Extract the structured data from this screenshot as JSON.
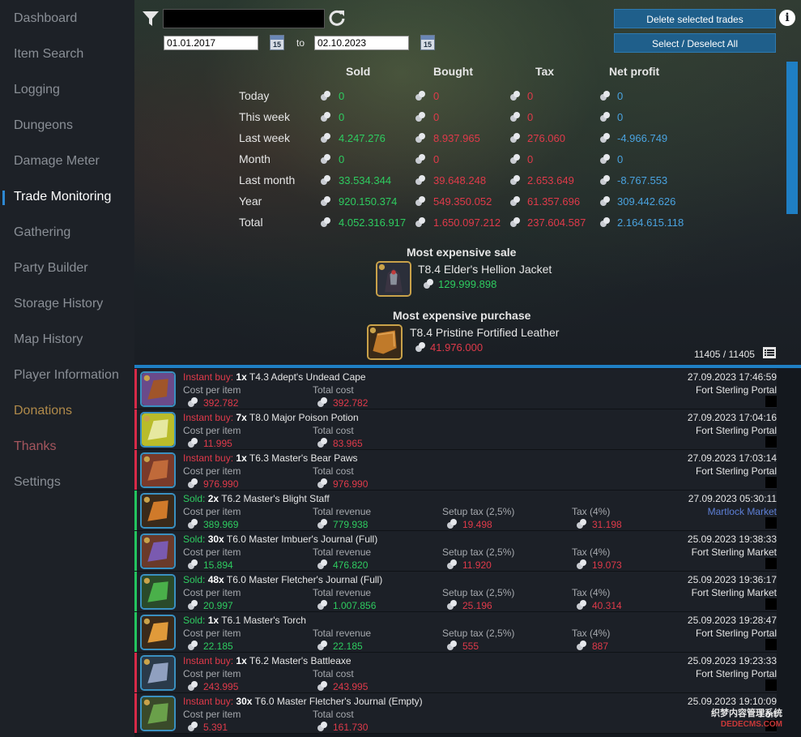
{
  "sidebar": {
    "items": [
      {
        "label": "Dashboard"
      },
      {
        "label": "Item Search"
      },
      {
        "label": "Logging"
      },
      {
        "label": "Dungeons"
      },
      {
        "label": "Damage Meter"
      },
      {
        "label": "Trade Monitoring"
      },
      {
        "label": "Gathering"
      },
      {
        "label": "Party Builder"
      },
      {
        "label": "Storage History"
      },
      {
        "label": "Map History"
      },
      {
        "label": "Player Information"
      },
      {
        "label": "Donations"
      },
      {
        "label": "Thanks"
      },
      {
        "label": "Settings"
      }
    ],
    "active": "Trade Monitoring"
  },
  "filter": {
    "search_value": "",
    "date_from": "01.01.2017",
    "to_label": "to",
    "date_to": "02.10.2023",
    "calendar_day": "15"
  },
  "buttons": {
    "delete": "Delete selected trades",
    "select_all": "Select / Deselect All"
  },
  "stats": {
    "headers": {
      "sold": "Sold",
      "bought": "Bought",
      "tax": "Tax",
      "net": "Net profit"
    },
    "rows": [
      {
        "label": "Today",
        "sold": "0",
        "bought": "0",
        "tax": "0",
        "net": "0"
      },
      {
        "label": "This week",
        "sold": "0",
        "bought": "0",
        "tax": "0",
        "net": "0"
      },
      {
        "label": "Last week",
        "sold": "4.247.276",
        "bought": "8.937.965",
        "tax": "276.060",
        "net": "-4.966.749"
      },
      {
        "label": "Month",
        "sold": "0",
        "bought": "0",
        "tax": "0",
        "net": "0"
      },
      {
        "label": "Last month",
        "sold": "33.534.344",
        "bought": "39.648.248",
        "tax": "2.653.649",
        "net": "-8.767.553"
      },
      {
        "label": "Year",
        "sold": "920.150.374",
        "bought": "549.350.052",
        "tax": "61.357.696",
        "net": "309.442.626"
      },
      {
        "label": "Total",
        "sold": "4.052.316.917",
        "bought": "1.650.097.212",
        "tax": "237.604.587",
        "net": "2.164.615.118"
      }
    ]
  },
  "most_expensive_sale": {
    "title": "Most expensive sale",
    "item": "T8.4 Elder's Hellion Jacket",
    "value": "129.999.898"
  },
  "most_expensive_purchase": {
    "title": "Most expensive purchase",
    "item": "T8.4 Pristine Fortified Leather",
    "value": "41.976.000"
  },
  "count": "11405 / 11405",
  "trades": [
    {
      "kind": "Instant buy:",
      "qty": "1x",
      "item": "T4.3 Adept's Undead Cape",
      "lbl1": "Cost per item",
      "v1": "392.782",
      "lbl2": "Total cost",
      "v2": "392.782",
      "date": "27.09.2023 17:46:59",
      "location": "Fort Sterling Portal"
    },
    {
      "kind": "Instant buy:",
      "qty": "7x",
      "item": "T8.0 Major Poison Potion",
      "lbl1": "Cost per item",
      "v1": "11.995",
      "lbl2": "Total cost",
      "v2": "83.965",
      "date": "27.09.2023 17:04:16",
      "location": "Fort Sterling Portal"
    },
    {
      "kind": "Instant buy:",
      "qty": "1x",
      "item": "T6.3 Master's Bear Paws",
      "lbl1": "Cost per item",
      "v1": "976.990",
      "lbl2": "Total cost",
      "v2": "976.990",
      "date": "27.09.2023 17:03:14",
      "location": "Fort Sterling Portal"
    },
    {
      "kind": "Sold:",
      "qty": "2x",
      "item": "T6.2 Master's Blight Staff",
      "lbl1": "Cost per item",
      "v1": "389.969",
      "lbl2": "Total revenue",
      "v2": "779.938",
      "lbl3": "Setup tax (2,5%)",
      "v3": "19.498",
      "lbl4": "Tax (4%)",
      "v4": "31.198",
      "date": "27.09.2023 05:30:11",
      "location": "Martlock Market"
    },
    {
      "kind": "Sold:",
      "qty": "30x",
      "item": "T6.0 Master Imbuer's Journal (Full)",
      "lbl1": "Cost per item",
      "v1": "15.894",
      "lbl2": "Total revenue",
      "v2": "476.820",
      "lbl3": "Setup tax (2,5%)",
      "v3": "11.920",
      "lbl4": "Tax (4%)",
      "v4": "19.073",
      "date": "25.09.2023 19:38:33",
      "location": "Fort Sterling Market"
    },
    {
      "kind": "Sold:",
      "qty": "48x",
      "item": "T6.0 Master Fletcher's Journal (Full)",
      "lbl1": "Cost per item",
      "v1": "20.997",
      "lbl2": "Total revenue",
      "v2": "1.007.856",
      "lbl3": "Setup tax (2,5%)",
      "v3": "25.196",
      "lbl4": "Tax (4%)",
      "v4": "40.314",
      "date": "25.09.2023 19:36:17",
      "location": "Fort Sterling Market"
    },
    {
      "kind": "Sold:",
      "qty": "1x",
      "item": "T6.1 Master's Torch",
      "lbl1": "Cost per item",
      "v1": "22.185",
      "lbl2": "Total revenue",
      "v2": "22.185",
      "lbl3": "Setup tax (2,5%)",
      "v3": "555",
      "lbl4": "Tax (4%)",
      "v4": "887",
      "date": "25.09.2023 19:28:47",
      "location": "Fort Sterling Portal"
    },
    {
      "kind": "Instant buy:",
      "qty": "1x",
      "item": "T6.2 Master's Battleaxe",
      "lbl1": "Cost per item",
      "v1": "243.995",
      "lbl2": "Total cost",
      "v2": "243.995",
      "date": "25.09.2023 19:23:33",
      "location": "Fort Sterling Portal"
    },
    {
      "kind": "Instant buy:",
      "qty": "30x",
      "item": "T6.0 Master Fletcher's Journal (Empty)",
      "lbl1": "Cost per item",
      "v1": "5.391",
      "lbl2": "Total cost",
      "v2": "161.730",
      "date": "25.09.2023 19:10:09",
      "location": "Fort"
    }
  ],
  "watermark": {
    "line1": "织梦内容管理系统",
    "line2": "DEDECMS.COM"
  },
  "colors": {
    "accent": "#1f7fc4",
    "profit": "#2ecc60",
    "loss": "#e03a4a",
    "net": "#4aa3e0"
  }
}
